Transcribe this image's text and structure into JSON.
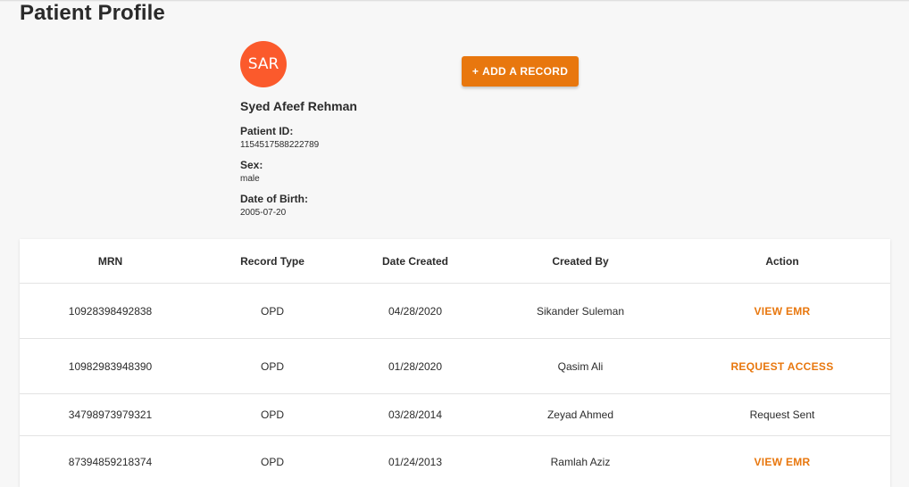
{
  "page": {
    "title": "Patient Profile"
  },
  "patient": {
    "avatar_initials": "SAR",
    "avatar_color": "#fb5a2c",
    "name": "Syed Afeef Rehman",
    "fields": [
      {
        "label": "Patient ID:",
        "value": "1154517588222789"
      },
      {
        "label": "Sex:",
        "value": "male"
      },
      {
        "label": "Date of Birth:",
        "value": "2005-07-20"
      }
    ]
  },
  "actions": {
    "add_record_icon": "+",
    "add_record_label": "ADD A RECORD",
    "accent_color": "#e8770e"
  },
  "records_table": {
    "columns": [
      "MRN",
      "Record Type",
      "Date Created",
      "Created By",
      "Action"
    ],
    "rows": [
      {
        "mrn": "10928398492838",
        "type": "OPD",
        "date": "04/28/2020",
        "created_by": "Sikander Suleman",
        "action": "VIEW EMR",
        "action_style": "link"
      },
      {
        "mrn": "10982983948390",
        "type": "OPD",
        "date": "01/28/2020",
        "created_by": "Qasim Ali",
        "action": "REQUEST ACCESS",
        "action_style": "link"
      },
      {
        "mrn": "34798973979321",
        "type": "OPD",
        "date": "03/28/2014",
        "created_by": "Zeyad Ahmed",
        "action": "Request Sent",
        "action_style": "text"
      },
      {
        "mrn": "87394859218374",
        "type": "OPD",
        "date": "01/24/2013",
        "created_by": "Ramlah Aziz",
        "action": "VIEW EMR",
        "action_style": "link"
      }
    ]
  }
}
